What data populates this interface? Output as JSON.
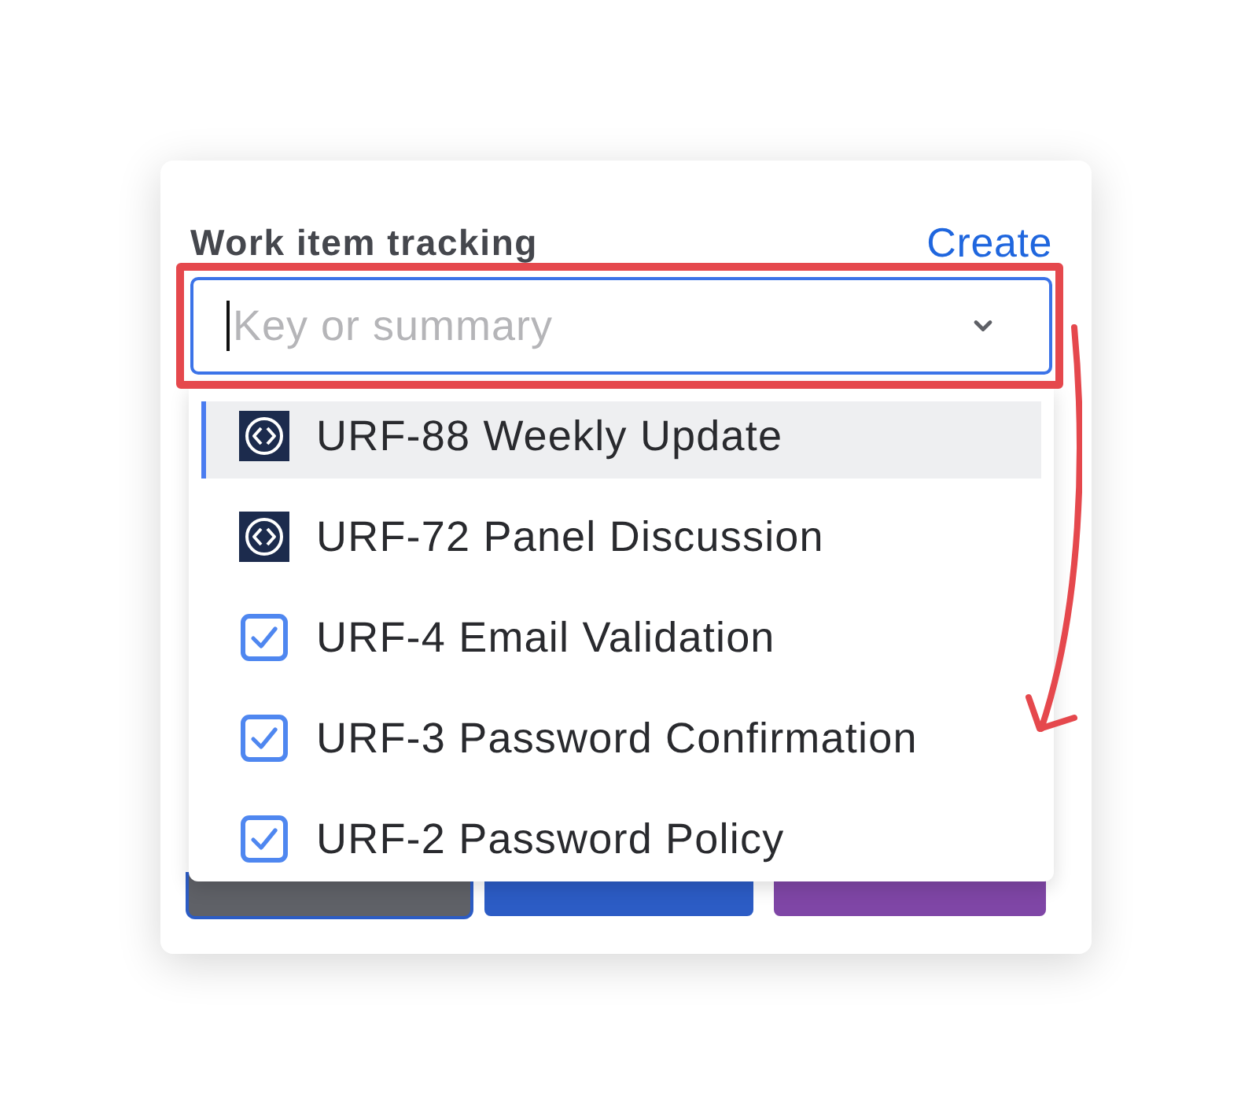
{
  "field": {
    "label": "Work item tracking",
    "action": "Create",
    "placeholder": "Key or summary",
    "focused": true
  },
  "menu": {
    "items": [
      {
        "kind": "feature",
        "text": "URF-88 Weekly Update",
        "selected": true
      },
      {
        "kind": "feature",
        "text": "URF-72 Panel Discussion",
        "selected": false
      },
      {
        "kind": "task",
        "text": "URF-4 Email Validation",
        "selected": false
      },
      {
        "kind": "task",
        "text": "URF-3 Password Confirmation",
        "selected": false
      },
      {
        "kind": "task",
        "text": "URF-2 Password Policy",
        "selected": false
      }
    ]
  },
  "buttons_behind_menu": [
    {
      "color": "#5f6167",
      "focused": true
    },
    {
      "color": "#2c5cc5",
      "focused": false
    },
    {
      "color": "#7f46a6",
      "focused": false
    }
  ],
  "annotation": {
    "highlight_box": true,
    "arrow": true
  }
}
